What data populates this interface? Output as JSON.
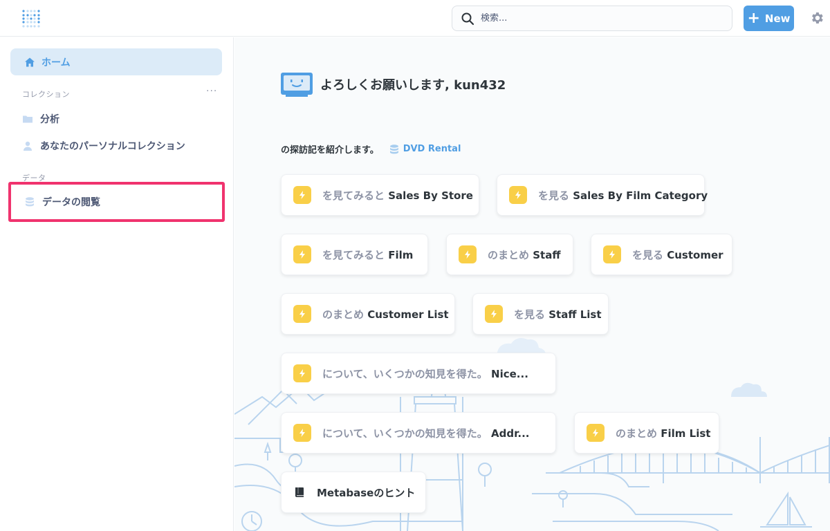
{
  "header": {
    "search_placeholder": "検索...",
    "new_label": "New"
  },
  "sidebar": {
    "home_label": "ホーム",
    "collections_label": "コレクション",
    "more_label": "···",
    "collections": [
      {
        "label": "分析"
      },
      {
        "label": "あなたのパーソナルコレクション"
      }
    ],
    "data_label": "データ",
    "browse_data_label": "データの閲覧"
  },
  "main": {
    "greeting": "よろしくお願いします, kun432",
    "intro_text": "の探訪記を紹介します。",
    "database_name": "DVD Rental",
    "xrays": [
      {
        "prefix": "を見てみると",
        "name": "Sales By Store"
      },
      {
        "prefix": "を見る",
        "name": "Sales By Film Category"
      },
      {
        "prefix": "を見てみると",
        "name": "Film"
      },
      {
        "prefix": "のまとめ",
        "name": "Staff"
      },
      {
        "prefix": "を見る",
        "name": "Customer"
      },
      {
        "prefix": "のまとめ",
        "name": "Customer List"
      },
      {
        "prefix": "を見る",
        "name": "Staff List"
      },
      {
        "prefix": "について、いくつかの知見を得た。",
        "name": "Nice..."
      },
      {
        "prefix": "について、いくつかの知見を得た。",
        "name": "Addr..."
      },
      {
        "prefix": "のまとめ",
        "name": "Film List"
      }
    ],
    "tips_label": "Metabaseのヒント"
  },
  "colors": {
    "brand": "#509ee3",
    "highlight": "#f0336e",
    "bolt": "#f9cf48"
  }
}
